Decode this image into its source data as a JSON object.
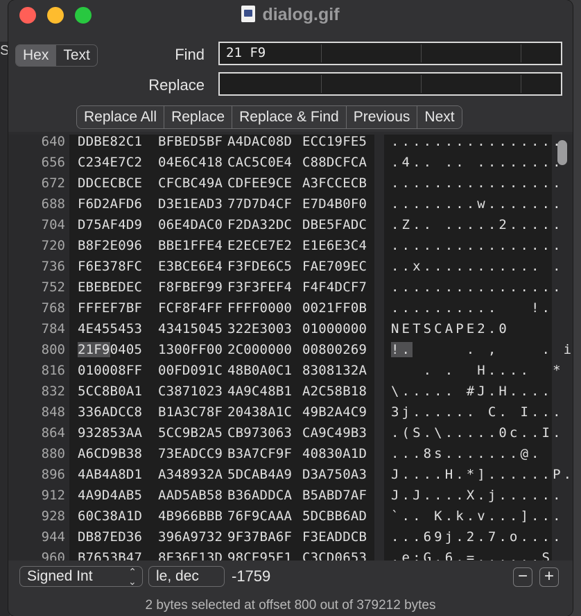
{
  "window": {
    "title": "dialog.gif"
  },
  "mode_tabs": [
    {
      "label": "Hex",
      "selected": true
    },
    {
      "label": "Text",
      "selected": false
    }
  ],
  "find": {
    "label": "Find",
    "value": "21 F9"
  },
  "replace": {
    "label": "Replace",
    "value": ""
  },
  "actions": [
    "Replace All",
    "Replace",
    "Replace & Find",
    "Previous",
    "Next"
  ],
  "rows": [
    {
      "offset": "640",
      "hex": [
        "DDBE82C1",
        "BFBED5BF",
        "A4DAC08D",
        "ECC19FE5"
      ],
      "ascii": "................"
    },
    {
      "offset": "656",
      "hex": [
        "C234E7C2",
        "04E6C418",
        "CAC5C0E4",
        "C88DCFCA"
      ],
      "ascii": ".4.. .. ........"
    },
    {
      "offset": "672",
      "hex": [
        "DDCECBCE",
        "CFCBC49A",
        "CDFEE9CE",
        "A3FCCECB"
      ],
      "ascii": "................"
    },
    {
      "offset": "688",
      "hex": [
        "F6D2AFD6",
        "D3E1EAD3",
        "77D7D4CF",
        "E7D4B0F0"
      ],
      "ascii": "........w......."
    },
    {
      "offset": "704",
      "hex": [
        "D75AF4D9",
        "06E4DAC0",
        "F2DA32DC",
        "DBE5FADC"
      ],
      "ascii": ".Z.. .....2....."
    },
    {
      "offset": "720",
      "hex": [
        "B8F2E096",
        "BBE1FFE4",
        "E2ECE7E2",
        "E1E6E3C4"
      ],
      "ascii": "................"
    },
    {
      "offset": "736",
      "hex": [
        "F6E378FC",
        "E3BCE6E4",
        "F3FDE6C5",
        "FAE709EC"
      ],
      "ascii": "..x........... ."
    },
    {
      "offset": "752",
      "hex": [
        "EBEBEDEC",
        "F8FBEF99",
        "F3F3FEF4",
        "F4F4DCF7"
      ],
      "ascii": "................"
    },
    {
      "offset": "768",
      "hex": [
        "FFFEF7BF",
        "FCF8F4FF",
        "FFFF0000",
        "0021FF0B"
      ],
      "ascii": "..........   !. "
    },
    {
      "offset": "784",
      "hex": [
        "4E455453",
        "43415045",
        "322E3003",
        "01000000"
      ],
      "ascii": "NETSCAPE2.0     "
    },
    {
      "offset": "800",
      "hex": [
        "21F90405",
        "1300FF00",
        "2C000000",
        "00800269"
      ],
      "ascii": "!.     . ,    . i"
    },
    {
      "offset": "816",
      "hex": [
        "010008FF",
        "00FD091C",
        "48B0A0C1",
        "8308132A"
      ],
      "ascii": "   . .  H....  *"
    },
    {
      "offset": "832",
      "hex": [
        "5CC8B0A1",
        "C3871023",
        "4A9C48B1",
        "A2C58B18"
      ],
      "ascii": "\\..... #J.H.... "
    },
    {
      "offset": "848",
      "hex": [
        "336ADCC8",
        "B1A3C78F",
        "20438A1C",
        "49B2A4C9"
      ],
      "ascii": "3j...... C. I..."
    },
    {
      "offset": "864",
      "hex": [
        "932853AA",
        "5CC9B2A5",
        "CB973063",
        "CA9C49B3"
      ],
      "ascii": ".(S.\\.....0c..I."
    },
    {
      "offset": "880",
      "hex": [
        "A6CD9B38",
        "73EADCC9",
        "B3A7CF9F",
        "40830A1D"
      ],
      "ascii": "...8s.......@. "
    },
    {
      "offset": "896",
      "hex": [
        "4AB4A8D1",
        "A348932A",
        "5DCAB4A9",
        "D3A750A3"
      ],
      "ascii": "J....H.*]......P."
    },
    {
      "offset": "912",
      "hex": [
        "4A9D4AB5",
        "AAD5AB58",
        "B36ADDCA",
        "B5ABD7AF"
      ],
      "ascii": "J.J....X.j......"
    },
    {
      "offset": "928",
      "hex": [
        "60C38A1D",
        "4B966BBB",
        "76F9CAAA",
        "5DCBB6AD"
      ],
      "ascii": "`.. K.k.v...]..."
    },
    {
      "offset": "944",
      "hex": [
        "DB87ED36",
        "396A9732",
        "9F37BA6F",
        "F3EADDCB"
      ],
      "ascii": "...69j.2.7.o...."
    },
    {
      "offset": "960",
      "hex": [
        "B7653B47",
        "8E36E13D",
        "98CE95E1",
        "C3CD0653"
      ],
      "ascii": ".e;G.6.=......S"
    }
  ],
  "inspector": {
    "type": "Signed Int",
    "format": "le, dec",
    "value": "-1759",
    "minus": "−",
    "plus": "+"
  },
  "status": "2 bytes selected at offset 800 out of 379212 bytes"
}
